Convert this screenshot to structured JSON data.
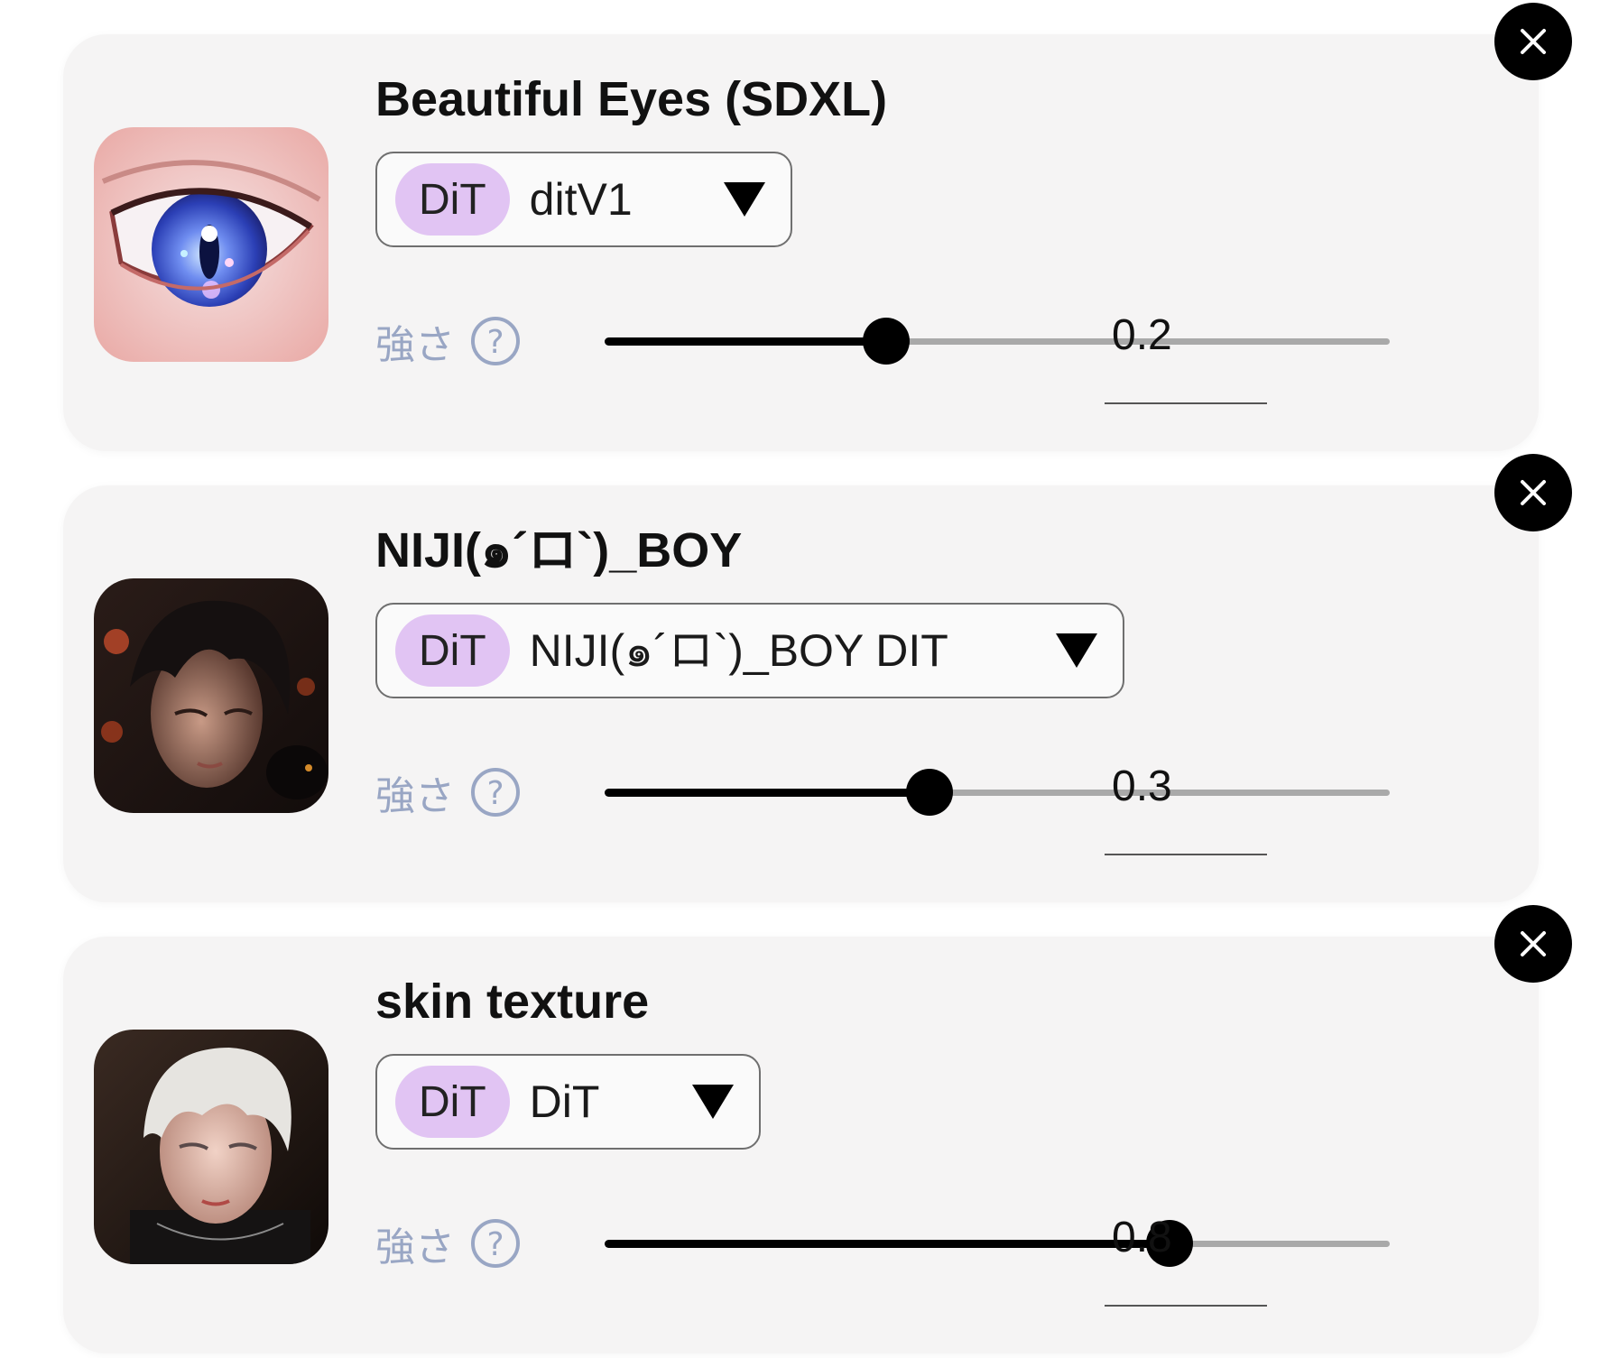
{
  "strength_label": "強さ",
  "items": [
    {
      "title": "Beautiful Eyes (SDXL)",
      "architecture": "DiT",
      "version": "ditV1",
      "strength": 0.2,
      "strength_text": "0.2",
      "thumbnail": "eye-illustration-thumbnail"
    },
    {
      "title": "NIJI(๑´ロ`)_BOY",
      "architecture": "DiT",
      "version": "NIJI(๑´ロ`)_BOY DIT",
      "strength": 0.3,
      "strength_text": "0.3",
      "thumbnail": "dark-hair-boy-thumbnail"
    },
    {
      "title": "skin texture",
      "architecture": "DiT",
      "version": "DiT",
      "strength": 0.8,
      "strength_text": "0.8",
      "thumbnail": "white-hair-boy-thumbnail"
    }
  ],
  "colors": {
    "card_background": "#f5f4f4",
    "badge_background": "#e1c4f3",
    "label_color": "#99a6c4",
    "slider_fill": "#000000",
    "slider_track": "#a9a9a9"
  }
}
